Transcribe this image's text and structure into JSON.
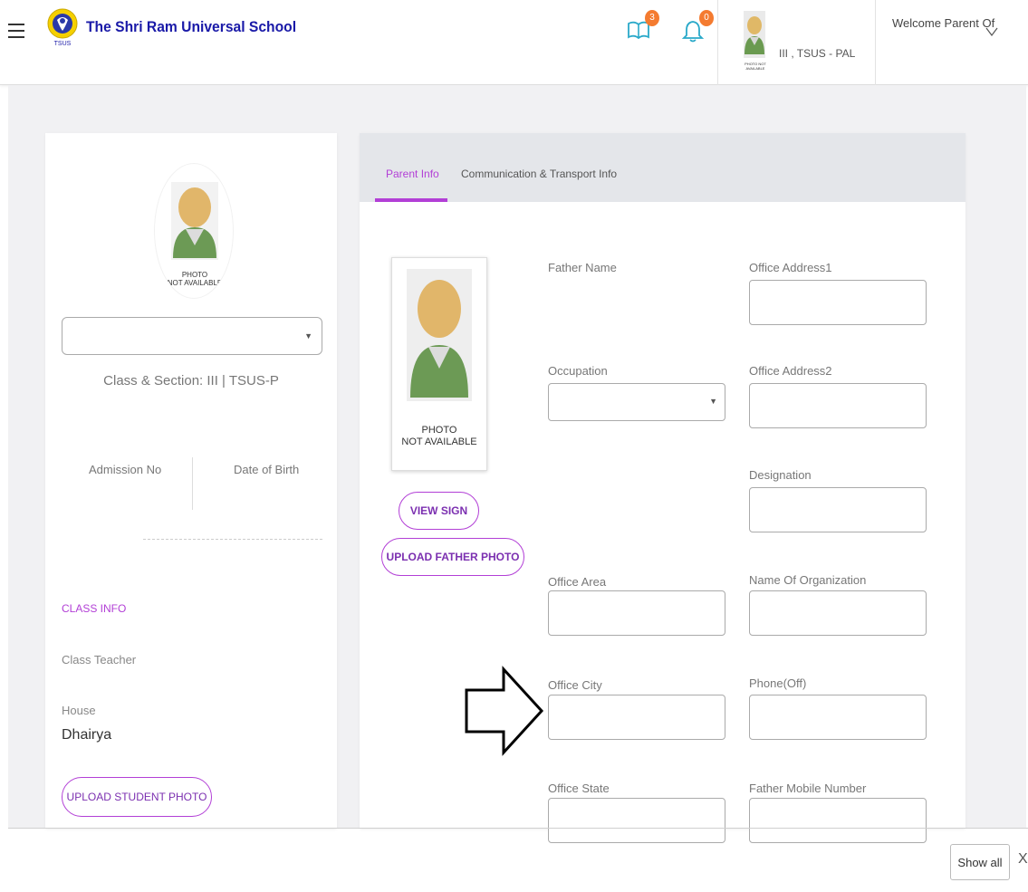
{
  "header": {
    "school_name": "The Shri Ram Universal School",
    "logo_text": "TSUS",
    "books_badge": "3",
    "bell_badge": "0",
    "profile_thumb_text": "PHOTO NOT AVAILABLE",
    "profile_class": "III , TSUS - PAL",
    "welcome": "Welcome Parent Of"
  },
  "student_card": {
    "photo_text_1": "PHOTO",
    "photo_text_2": "NOT AVAILABLE",
    "student_select_value": "",
    "class_section": "Class & Section: III | TSUS-P",
    "admission_no_label": "Admission No",
    "dob_label": "Date of Birth",
    "class_info_heading": "CLASS INFO",
    "class_teacher_label": "Class Teacher",
    "house_label": "House",
    "house_value": "Dhairya",
    "upload_student_photo": "UPLOAD STUDENT PHOTO"
  },
  "parent_panel": {
    "tabs": [
      {
        "label": "Parent Info",
        "active": true
      },
      {
        "label": "Communication & Transport Info",
        "active": false
      }
    ],
    "photo_text_1": "PHOTO",
    "photo_text_2": "NOT AVAILABLE",
    "view_sign": "VIEW SIGN",
    "upload_father_photo": "UPLOAD FATHER PHOTO",
    "fields": {
      "father_name": "Father Name",
      "occupation": "Occupation",
      "office_area": "Office Area",
      "office_city": "Office City",
      "office_state": "Office State",
      "office_address1": "Office Address1",
      "office_address2": "Office Address2",
      "designation": "Designation",
      "name_of_organization": "Name Of Organization",
      "phone_off": "Phone(Off)",
      "father_mobile": "Father Mobile Number"
    }
  },
  "download_bar": {
    "show_all": "Show all",
    "close": "X"
  },
  "colors": {
    "accent": "#b23fd6",
    "brand": "#1a1aa8",
    "badge": "#f47b30"
  }
}
